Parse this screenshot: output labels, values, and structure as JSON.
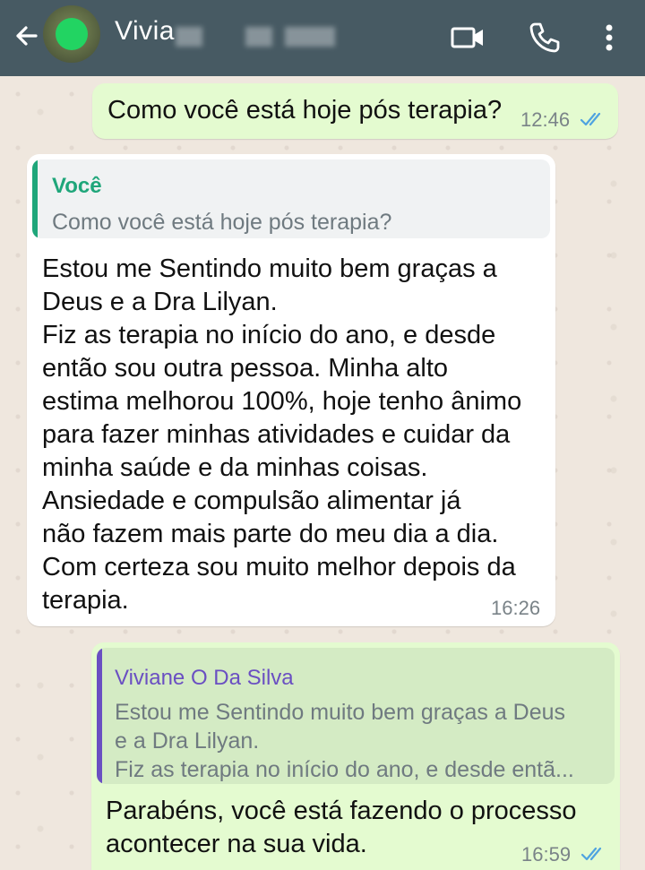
{
  "header": {
    "contact_name": "Vivia",
    "back_icon": "arrow-left-icon",
    "video_icon": "video-camera-icon",
    "call_icon": "phone-icon",
    "menu_icon": "more-vertical-icon",
    "background_color": "#475a63"
  },
  "messages": [
    {
      "direction": "outgoing",
      "text": "Como você está hoje pós terapia?",
      "time": "12:46",
      "status_icon": "double-check-read-icon"
    },
    {
      "direction": "incoming",
      "quote": {
        "author": "Você",
        "text": "Como você está hoje pós terapia?"
      },
      "lines": [
        "Estou me Sentindo muito bem graças a",
        "Deus e a Dra Lilyan.",
        "Fiz as terapia no início do ano, e desde",
        "então sou outra pessoa. Minha alto",
        "estima melhorou 100%, hoje tenho ânimo",
        "para fazer minhas atividades e cuidar da",
        "minha saúde e da minhas coisas.",
        "Ansiedade e compulsão alimentar já",
        "não fazem mais parte do meu dia a dia.",
        "Com certeza sou muito melhor depois da",
        "terapia."
      ],
      "time": "16:26"
    },
    {
      "direction": "outgoing",
      "quote": {
        "author": "Viviane O Da Silva",
        "lines": [
          "Estou me Sentindo muito bem graças a Deus",
          "e a Dra Lilyan.",
          "Fiz as terapia no início do ano, e desde entã..."
        ]
      },
      "lines": [
        "Parabéns, você está fazendo o processo",
        "acontecer na sua vida."
      ],
      "time": "16:59",
      "status_icon": "double-check-read-icon"
    }
  ],
  "colors": {
    "outgoing_bubble": "#e4fbd0",
    "incoming_bubble": "#ffffff",
    "quote_self": "#1fa67a",
    "quote_contact": "#6a4fc2",
    "read_tick": "#4fa3e0"
  }
}
